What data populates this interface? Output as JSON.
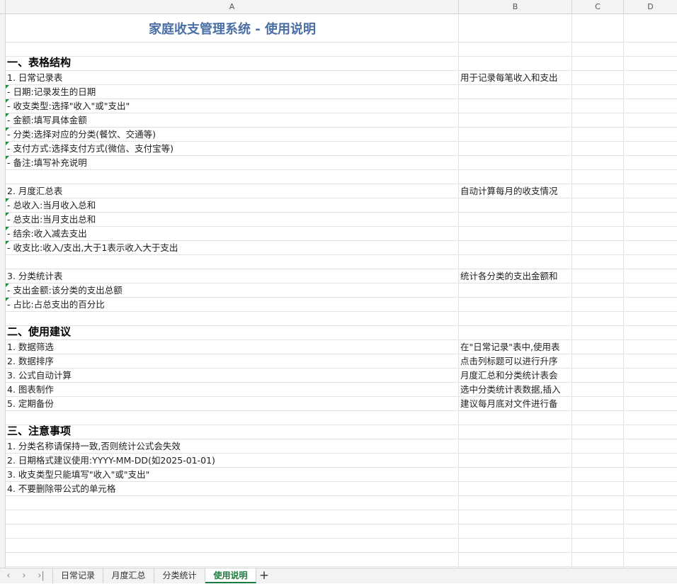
{
  "columns": [
    "A",
    "B",
    "C",
    "D"
  ],
  "rows": [
    {
      "type": "title",
      "a": "家庭收支管理系统 - 使用说明",
      "b": ""
    },
    {
      "type": "blank",
      "a": "",
      "b": ""
    },
    {
      "type": "section",
      "a": "一、表格结构",
      "b": ""
    },
    {
      "type": "text",
      "a": "1. 日常记录表",
      "b": "用于记录每笔收入和支出"
    },
    {
      "type": "item",
      "a": " - 日期:记录发生的日期",
      "b": ""
    },
    {
      "type": "item",
      "a": " - 收支类型:选择\"收入\"或\"支出\"",
      "b": ""
    },
    {
      "type": "item",
      "a": " - 金额:填写具体金额",
      "b": ""
    },
    {
      "type": "item",
      "a": " - 分类:选择对应的分类(餐饮、交通等)",
      "b": ""
    },
    {
      "type": "item",
      "a": " - 支付方式:选择支付方式(微信、支付宝等)",
      "b": ""
    },
    {
      "type": "item",
      "a": " - 备注:填写补充说明",
      "b": ""
    },
    {
      "type": "blank",
      "a": "",
      "b": ""
    },
    {
      "type": "text",
      "a": "2. 月度汇总表",
      "b": "自动计算每月的收支情况"
    },
    {
      "type": "item",
      "a": " - 总收入:当月收入总和",
      "b": ""
    },
    {
      "type": "item",
      "a": " - 总支出:当月支出总和",
      "b": ""
    },
    {
      "type": "item",
      "a": " - 结余:收入减去支出",
      "b": ""
    },
    {
      "type": "item",
      "a": " - 收支比:收入/支出,大于1表示收入大于支出",
      "b": ""
    },
    {
      "type": "blank",
      "a": "",
      "b": ""
    },
    {
      "type": "text",
      "a": "3. 分类统计表",
      "b": "统计各分类的支出金额和"
    },
    {
      "type": "item",
      "a": " - 支出金额:该分类的支出总额",
      "b": ""
    },
    {
      "type": "item",
      "a": " - 占比:占总支出的百分比",
      "b": ""
    },
    {
      "type": "blank",
      "a": "",
      "b": ""
    },
    {
      "type": "section",
      "a": "二、使用建议",
      "b": ""
    },
    {
      "type": "text",
      "a": "1. 数据筛选",
      "b": "在\"日常记录\"表中,使用表"
    },
    {
      "type": "text",
      "a": "2. 数据排序",
      "b": "点击列标题可以进行升序"
    },
    {
      "type": "text",
      "a": "3. 公式自动计算",
      "b": "月度汇总和分类统计表会"
    },
    {
      "type": "text",
      "a": "4. 图表制作",
      "b": "选中分类统计表数据,插入"
    },
    {
      "type": "text",
      "a": "5. 定期备份",
      "b": "建议每月底对文件进行备"
    },
    {
      "type": "blank",
      "a": "",
      "b": ""
    },
    {
      "type": "section",
      "a": "三、注意事项",
      "b": ""
    },
    {
      "type": "text",
      "a": "1. 分类名称请保持一致,否则统计公式会失效",
      "b": ""
    },
    {
      "type": "text",
      "a": "2. 日期格式建议使用:YYYY-MM-DD(如2025-01-01)",
      "b": ""
    },
    {
      "type": "text",
      "a": "3. 收支类型只能填写\"收入\"或\"支出\"",
      "b": ""
    },
    {
      "type": "text",
      "a": "4. 不要删除带公式的单元格",
      "b": ""
    },
    {
      "type": "blank",
      "a": "",
      "b": ""
    },
    {
      "type": "blank",
      "a": "",
      "b": ""
    },
    {
      "type": "blank",
      "a": "",
      "b": ""
    },
    {
      "type": "blank",
      "a": "",
      "b": ""
    },
    {
      "type": "blank",
      "a": "",
      "b": ""
    }
  ],
  "tabs": {
    "nav_first": "‹",
    "nav_prev": "›",
    "nav_last": "›|",
    "items": [
      "日常记录",
      "月度汇总",
      "分类统计",
      "使用说明"
    ],
    "active": 3,
    "add": "+"
  },
  "colors": {
    "title": "#4a6fa5",
    "active_tab": "#1e7a3f",
    "comment_marker": "#1e8a3f"
  }
}
